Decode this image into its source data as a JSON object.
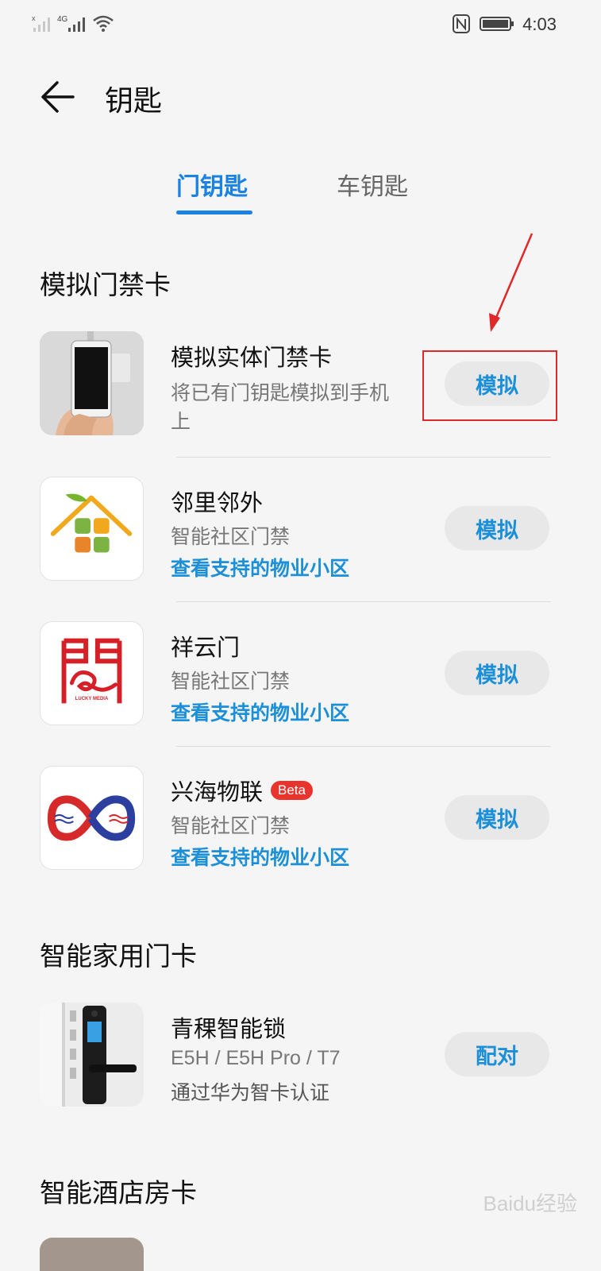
{
  "status_bar": {
    "network": "4G",
    "time": "4:03"
  },
  "header": {
    "title": "钥匙"
  },
  "tabs": [
    {
      "label": "门钥匙",
      "active": true
    },
    {
      "label": "车钥匙",
      "active": false
    }
  ],
  "sections": {
    "simulated": {
      "title": "模拟门禁卡",
      "items": [
        {
          "title": "模拟实体门禁卡",
          "subtitle_1": "将已有门钥匙模拟到手机",
          "subtitle_2": "上",
          "action": "模拟"
        },
        {
          "title": "邻里邻外",
          "subtitle": "智能社区门禁",
          "link": "查看支持的物业小区",
          "action": "模拟"
        },
        {
          "title": "祥云门",
          "subtitle": "智能社区门禁",
          "link": "查看支持的物业小区",
          "action": "模拟",
          "logo_text": "LUCKY MEDIA"
        },
        {
          "title": "兴海物联",
          "badge": "Beta",
          "subtitle": "智能社区门禁",
          "link": "查看支持的物业小区",
          "action": "模拟"
        }
      ]
    },
    "home": {
      "title": "智能家用门卡",
      "items": [
        {
          "title": "青稞智能锁",
          "subtitle": "E5H / E5H Pro / T7",
          "note": "通过华为智卡认证",
          "action": "配对"
        }
      ]
    },
    "hotel": {
      "title": "智能酒店房卡"
    }
  },
  "watermark": "Baidu经验",
  "colors": {
    "accent": "#1a82e2",
    "link": "#1b8fd8",
    "badge": "#e8342c",
    "annotation": "#e0282a"
  }
}
